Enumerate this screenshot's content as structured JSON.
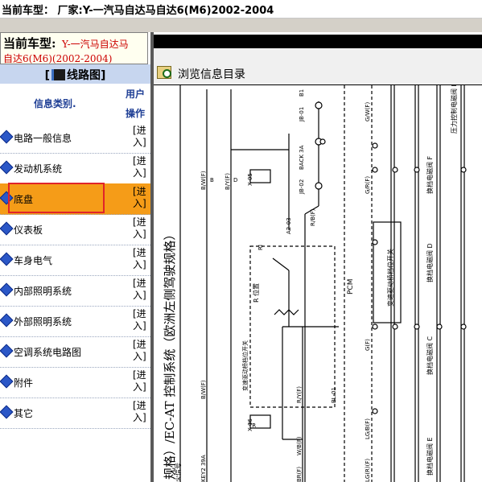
{
  "titlebar": {
    "text": "当前车型：  厂家:Y-一汽马自达马自达6(M6)2002-2004"
  },
  "left_panel": {
    "current_model_label": "当前车型:",
    "current_model_line1": "Y-一汽马自达马",
    "current_model_line2": "自达6(M6)(2002-2004)",
    "circuit_header_prefix": "[",
    "circuit_header_title": "线路图",
    "circuit_header_suffix": "]",
    "col_category": "信息类别.",
    "col_user_line1": "用户",
    "col_user_line2": "操作",
    "items": [
      {
        "label": "电路一般信息",
        "enter1": "[进",
        "enter2": "入]"
      },
      {
        "label": "发动机系统",
        "enter1": "[进",
        "enter2": "入]"
      },
      {
        "label": "底盘",
        "enter1": "[进",
        "enter2": "入]"
      },
      {
        "label": "仪表板",
        "enter1": "[进",
        "enter2": "入]"
      },
      {
        "label": "车身电气",
        "enter1": "[进",
        "enter2": "入]"
      },
      {
        "label": "内部照明系统",
        "enter1": "[进",
        "enter2": "入]"
      },
      {
        "label": "外部照明系统",
        "enter1": "[进",
        "enter2": "入]"
      },
      {
        "label": "空调系统电路图",
        "enter1": "[进",
        "enter2": "入]"
      },
      {
        "label": "附件",
        "enter1": "[进",
        "enter2": "入]"
      },
      {
        "label": "其它",
        "enter1": "[进",
        "enter2": "入]"
      }
    ],
    "active_item": "底盘"
  },
  "right_panel": {
    "browse_label": "浏览信息目录",
    "diagram_title": "规格）/EC-AT 控制系统（欧洲左侧驾驶规格）",
    "texts": {
      "b1": "B1",
      "jb01": "JB-01",
      "back3a": "BACK 3A",
      "jb02": "JB-02",
      "rbf": "R/B(F)",
      "x05": "X-05",
      "b": "B",
      "d": "D",
      "a203": "A2-03",
      "ri": "RI",
      "rpos": "R 位置",
      "bwf": "B/W(F)",
      "bwf2": "B/W(F)",
      "byf": "B/Y(F)",
      "ryf": "R/Y(F)",
      "bl01": "BL-01",
      "tr": "TR",
      "x06": "X-06",
      "wbf": "W/B(F)",
      "brf": "BR(F)",
      "lgbf": "LG/B(F)",
      "lgrf": "LG(R)(F)",
      "gwf": "G/W(F)",
      "grf": "G/R(F)",
      "gif": "G(F)",
      "pcm": "PCM",
      "key2": "KEY2 39A",
      "switch_vtxt": "变速驱动桥档位开关",
      "switch_vtxt2": "变速驱动桥档位开关",
      "sol_f": "换档电磁阀 F",
      "sol_d": "换档电磁阀 D",
      "sol_c": "换档电磁阀 C",
      "sol_e": "换档电磁阀 E",
      "pressure": "压力控制电磁阀 E",
      "fire": "火信号"
    }
  }
}
